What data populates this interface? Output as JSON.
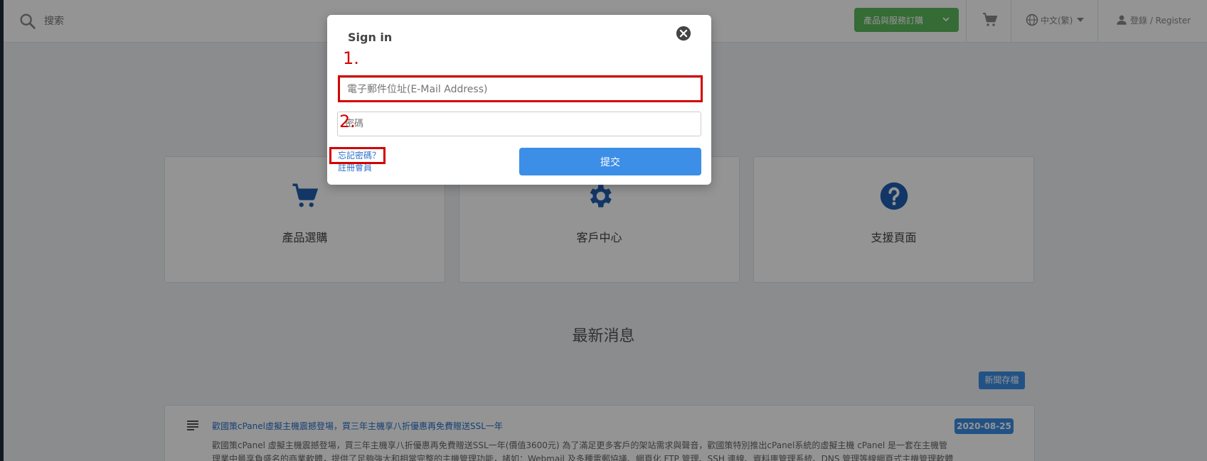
{
  "header": {
    "search_placeholder": "搜索",
    "order_button_label": "產品與服務訂購",
    "language_label": "中文(繁)",
    "login_label": "登錄 / Register"
  },
  "cards": [
    {
      "label": "產品選購",
      "icon": "cart-icon"
    },
    {
      "label": "客戶中心",
      "icon": "gear-icon"
    },
    {
      "label": "支援頁面",
      "icon": "help-icon"
    }
  ],
  "news": {
    "section_title": "最新消息",
    "archive_label": "新聞存檔",
    "items": [
      {
        "title": "歡國策cPanel虛擬主機震撼登場，買三年主機享八折優惠再免費贈送SSL一年",
        "date": "2020-08-25",
        "body": "歡國策cPanel 虛擬主機震撼登場，買三年主機享八折優惠再免費贈送SSL一年(價值3600元) 為了滿足更多客戶的架站需求與聲音，歡國策特別推出cPanel系統的虛擬主機 cPanel 是一套在主機管理業中最享負盛名的商業軟體，提供了足夠強大和相當完整的主機管理功能，諸如：Webmail 及多種電郵協議、網頁化 FTP 管理、SSH 連線、資料庫管理系統、DNS 管理等線網頁式主機管理軟體功"
      }
    ]
  },
  "modal": {
    "title": "Sign in",
    "email_placeholder": "電子郵件位址(E-Mail Address)",
    "password_placeholder": "密碼",
    "forgot_label": "忘記密碼？",
    "register_label": "註冊會員",
    "submit_label": "提交"
  },
  "annotations": {
    "step1": "1.",
    "step2": "2."
  },
  "colors": {
    "accent_blue": "#3c8ee6",
    "order_green": "#5cb85c",
    "annotation_red": "#d40000"
  }
}
